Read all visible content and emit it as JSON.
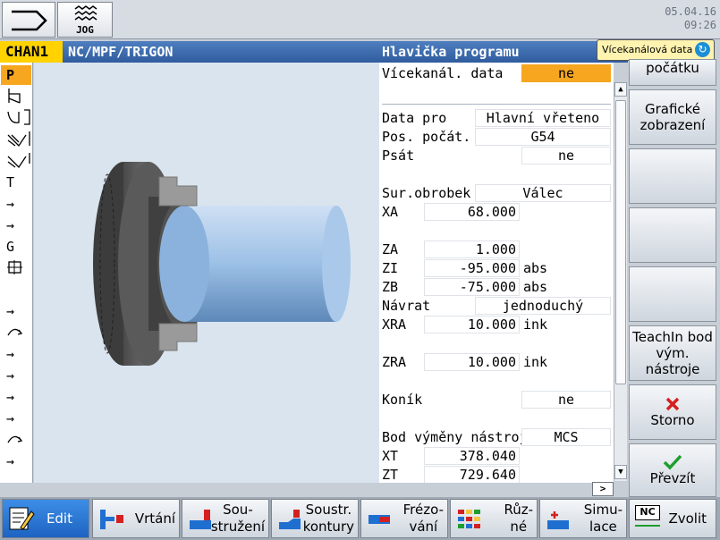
{
  "header": {
    "mode": "JOG",
    "date": "05.04.16",
    "time": "09:26"
  },
  "channel": {
    "name": "CHAN1",
    "path": "NC/MPF/TRIGON",
    "section": "Hlavička programu",
    "multichannel_badge": "Vícekanálová data"
  },
  "left_strip": [
    "P",
    "T",
    "→",
    "→",
    "G",
    "→",
    "→",
    "→",
    "→",
    "→",
    "→"
  ],
  "form": {
    "multichannel_label": "Vícekanál. data",
    "multichannel_value": "ne",
    "data_for_label": "Data pro",
    "data_for_value": "Hlavní vřeteno",
    "zero_offset_label": "Pos. počát.",
    "zero_offset_value": "G54",
    "write_label": "Psát",
    "write_value": "ne",
    "blank_label": "Sur.obrobek",
    "blank_value": "Válec",
    "xa_label": "XA",
    "xa_value": "68.000",
    "za_label": "ZA",
    "za_value": "1.000",
    "zi_label": "ZI",
    "zi_value": "-95.000",
    "zi_unit": "abs",
    "zb_label": "ZB",
    "zb_value": "-75.000",
    "zb_unit": "abs",
    "retract_label": "Návrat",
    "retract_value": "jednoduchý",
    "xra_label": "XRA",
    "xra_value": "10.000",
    "xra_unit": "ink",
    "zra_label": "ZRA",
    "zra_value": "10.000",
    "zra_unit": "ink",
    "tailstock_label": "Koník",
    "tailstock_value": "ne",
    "toolchange_label": "Bod výměny nástroje",
    "toolchange_value": "MCS",
    "xt_label": "XT",
    "xt_value": "378.040",
    "zt_label": "ZT",
    "zt_value": "729.640"
  },
  "scroll": {
    "right_arrow": ">"
  },
  "right_keys": {
    "origin": "počátku",
    "graphic_line1": "Grafické",
    "graphic_line2": "zobrazení",
    "teachin_line1": "TeachIn bod",
    "teachin_line2": "vým. nástroje",
    "cancel": "Storno",
    "accept": "Převzít"
  },
  "bottom_keys": {
    "edit": "Edit",
    "drilling": "Vrtání",
    "turning_l1": "Sou-",
    "turning_l2": "stružení",
    "contour_l1": "Soustr.",
    "contour_l2": "kontury",
    "milling_l1": "Frézo-",
    "milling_l2": "vání",
    "misc_l1": "Růz-",
    "misc_l2": "né",
    "sim_l1": "Simu-",
    "sim_l2": "lace",
    "select": "Zvolit",
    "nc_icon_text": "NC"
  },
  "colors": {
    "channel_bar": "#2f5c9e",
    "channel_name": "#ffd200",
    "highlight": "#f7a620",
    "active_key": "#1d63c2"
  }
}
